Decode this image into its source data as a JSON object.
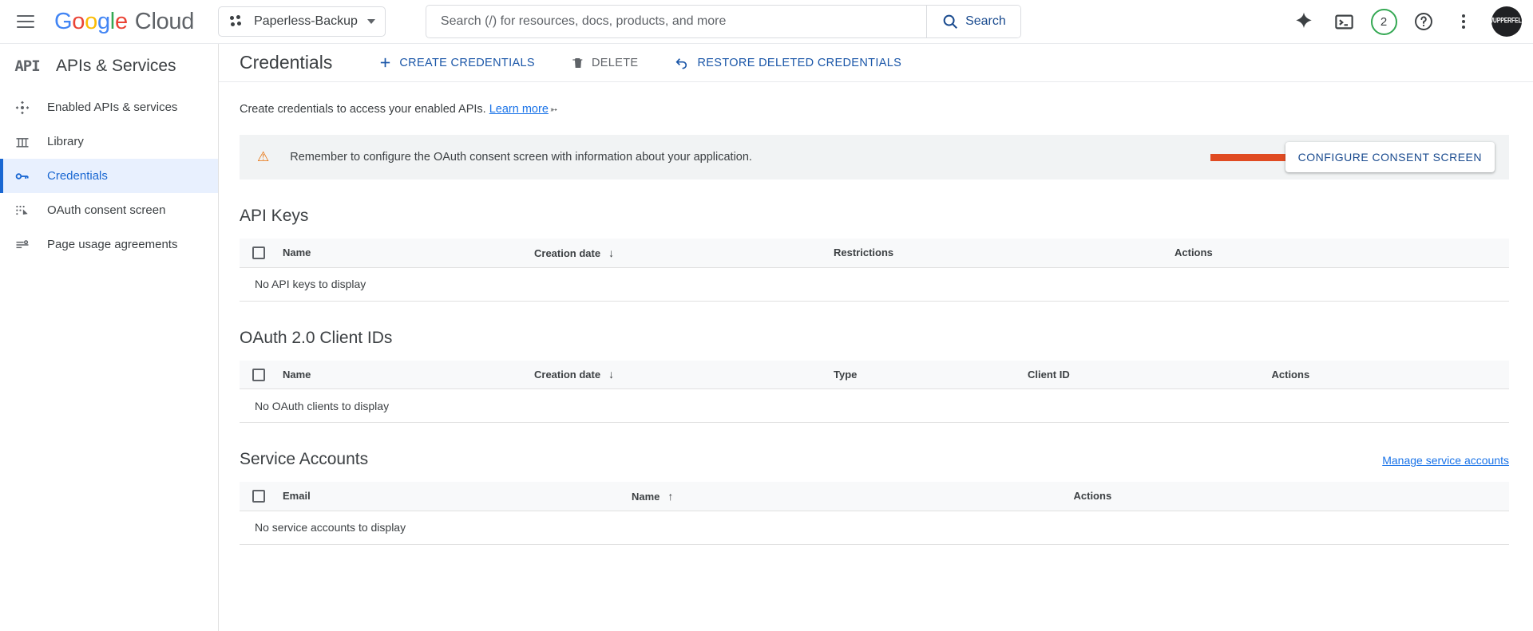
{
  "topbar": {
    "menu_icon": "hamburger-menu-icon",
    "brand": {
      "google": "Google",
      "cloud": "Cloud"
    },
    "project": {
      "name": "Paperless-Backup",
      "icon": "project-dots-icon"
    },
    "search": {
      "placeholder": "Search (/) for resources, docs, products, and more",
      "value": "",
      "button_label": "Search",
      "icon": "search-icon"
    },
    "icons": {
      "gemini": "gemini-spark-icon",
      "cloud_shell": "cloud-shell-terminal-icon",
      "notifications_count": "2",
      "help": "help-question-icon",
      "more": "more-vertical-kebab-icon",
      "avatar": "WUPPERFELD"
    }
  },
  "sidebar": {
    "service_title": "APIs & Services",
    "service_logo": "API",
    "items": [
      {
        "label": "Enabled APIs & services",
        "icon": "dashboard-enabled-apis-icon",
        "active": false
      },
      {
        "label": "Library",
        "icon": "library-columns-icon",
        "active": false
      },
      {
        "label": "Credentials",
        "icon": "key-icon",
        "active": true
      },
      {
        "label": "OAuth consent screen",
        "icon": "oauth-consent-icon",
        "active": false
      },
      {
        "label": "Page usage agreements",
        "icon": "page-usage-agreements-icon",
        "active": false
      }
    ]
  },
  "main": {
    "page_title": "Credentials",
    "actions": [
      {
        "label": "CREATE CREDENTIALS",
        "icon": "plus-icon",
        "disabled": false
      },
      {
        "label": "DELETE",
        "icon": "trash-icon",
        "disabled": true
      },
      {
        "label": "RESTORE DELETED CREDENTIALS",
        "icon": "undo-restore-icon",
        "disabled": false
      }
    ],
    "lead_text": "Create credentials to access your enabled APIs.",
    "learn_more": "Learn more",
    "learn_more_icon": "external-link-icon",
    "notice": {
      "icon": "warning-triangle-icon",
      "text": "Remember to configure the OAuth consent screen with information about your application.",
      "button_label": "CONFIGURE CONSENT SCREEN",
      "annotation": "red-arrow-pointing-right",
      "annotation_color": "#e04b22",
      "warning_color": "#e8710a"
    },
    "sections": [
      {
        "title": "API Keys",
        "columns": [
          "Name",
          "Creation date",
          "Restrictions",
          "Actions"
        ],
        "sort_column": "Creation date",
        "sort_direction": "down",
        "empty_text": "No API keys to display",
        "link": null
      },
      {
        "title": "OAuth 2.0 Client IDs",
        "columns": [
          "Name",
          "Creation date",
          "Type",
          "Client ID",
          "Actions"
        ],
        "sort_column": "Creation date",
        "sort_direction": "down",
        "empty_text": "No OAuth clients to display",
        "link": null
      },
      {
        "title": "Service Accounts",
        "columns": [
          "Email",
          "Name",
          "Actions"
        ],
        "sort_column": "Name",
        "sort_direction": "up",
        "empty_text": "No service accounts to display",
        "link": "Manage service accounts"
      }
    ]
  },
  "colors": {
    "accent_blue": "#1a73e8",
    "active_nav_bg": "#e8f0fe",
    "active_nav_fg": "#1967d2",
    "notice_bg": "#f1f3f4",
    "annotation_red": "#e04b22"
  }
}
